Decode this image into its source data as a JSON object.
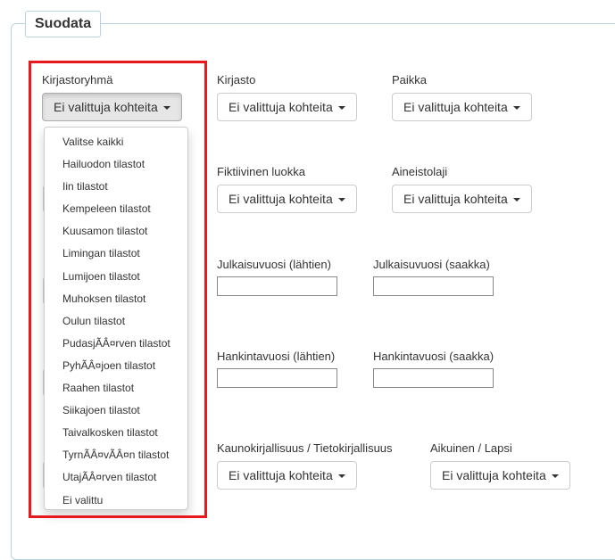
{
  "filter": {
    "title": "Suodata",
    "library_group": {
      "label": "Kirjastoryhmä",
      "button": "Ei valittuja kohteita",
      "options": [
        "Valitse kaikki",
        "Hailuodon tilastot",
        "Iin tilastot",
        "Kempeleen tilastot",
        "Kuusamon tilastot",
        "Limingan tilastot",
        "Lumijoen tilastot",
        "Muhoksen tilastot",
        "Oulun tilastot",
        "PudasjÃÂ¤rven tilastot",
        "PyhÃÂ¤joen tilastot",
        "Raahen tilastot",
        "Siikajoen tilastot",
        "Taivalkosken tilastot",
        "TyrnÃÂ¤vÃÂ¤n tilastot",
        "UtajÃÂ¤rven tilastot",
        "Ei valittu"
      ]
    },
    "library": {
      "label": "Kirjasto",
      "button": "Ei valittuja kohteita"
    },
    "place": {
      "label": "Paikka",
      "button": "Ei valittuja kohteita"
    },
    "fiction_class": {
      "label": "Fiktiivinen luokka",
      "button": "Ei valittuja kohteita"
    },
    "material_type": {
      "label": "Aineistolaji",
      "button": "Ei valittuja kohteita"
    },
    "pub_year_from": {
      "label": "Julkaisuvuosi (lähtien)",
      "value": ""
    },
    "pub_year_to": {
      "label": "Julkaisuvuosi (saakka)",
      "value": ""
    },
    "acq_year_from": {
      "label": "Hankintavuosi (lähtien)",
      "value": ""
    },
    "acq_year_to": {
      "label": "Hankintavuosi (saakka)",
      "value": ""
    },
    "fiction_nonfiction": {
      "label": "Kaunokirjallisuus / Tietokirjallisuus",
      "button": "Ei valittuja kohteita"
    },
    "adult_child": {
      "label": "Aikuinen / Lapsi",
      "button": "Ei valittuja kohteita"
    }
  },
  "colors": {
    "highlight_border": "#e8191e",
    "panel_border": "#b9d3de"
  }
}
